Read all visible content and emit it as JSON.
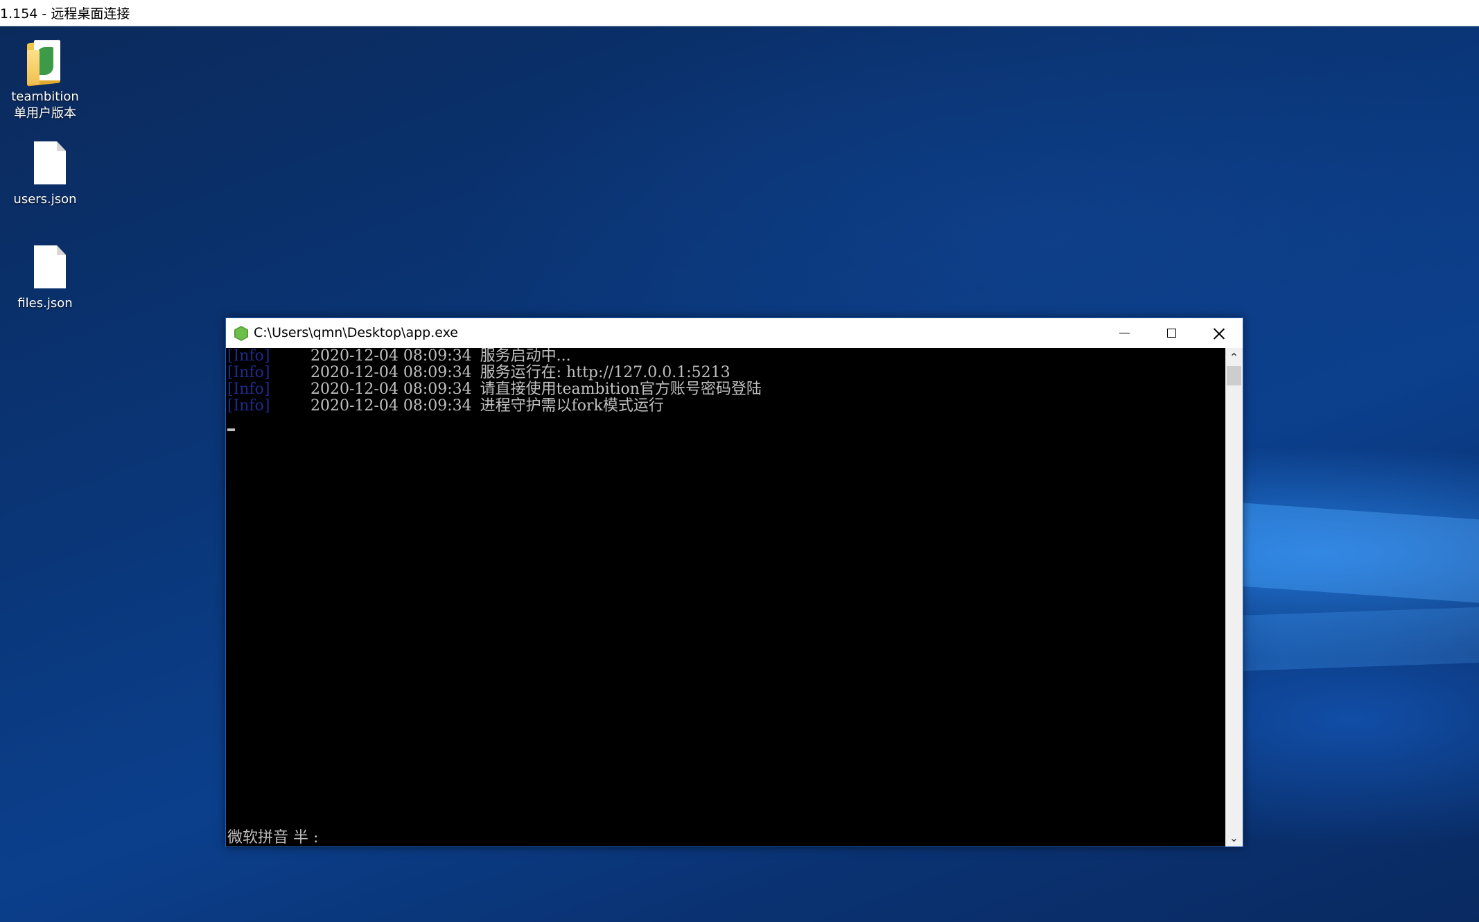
{
  "rdp": {
    "title": "1.154 - 远程桌面连接"
  },
  "desktop": {
    "icons": [
      {
        "line1": "teambition",
        "line2": "单用户版本",
        "icon": "teambition-folder-icon"
      },
      {
        "line1": "users.json",
        "icon": "file-icon"
      },
      {
        "line1": "files.json",
        "icon": "file-icon"
      }
    ]
  },
  "console": {
    "title": "C:\\Users\\qmn\\Desktop\\app.exe",
    "app_icon": "node-hexagon-icon",
    "lines": [
      {
        "tag": "[Info]",
        "time": "2020-12-04 08:09:34",
        "message": "服务启动中..."
      },
      {
        "tag": "[Info]",
        "time": "2020-12-04 08:09:34",
        "message": "服务运行在: http://127.0.0.1:5213"
      },
      {
        "tag": "[Info]",
        "time": "2020-12-04 08:09:34",
        "message": "请直接使用teambition官方账号密码登陆"
      },
      {
        "tag": "[Info]",
        "time": "2020-12-04 08:09:34",
        "message": "进程守护需以fork模式运行"
      }
    ],
    "ime_status": "微软拼音 半 :",
    "colors": {
      "tag": "#1f2a8c",
      "text": "#c0c0c0",
      "background": "#000000"
    }
  },
  "colors": {
    "desktop_dark": "#0a3576",
    "desktop_accent": "#2882e6",
    "window_border": "#1f5fb4"
  }
}
